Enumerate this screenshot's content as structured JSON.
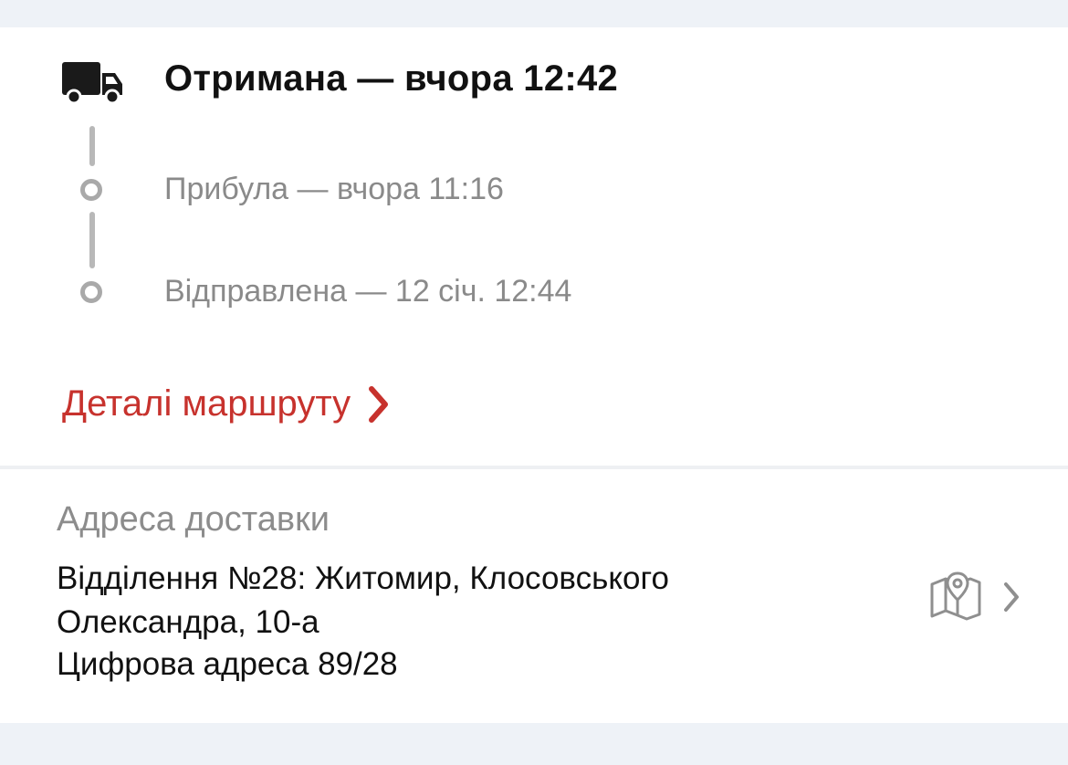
{
  "tracking": {
    "current_status": "Отримана — вчора 12:42",
    "history": [
      {
        "text": "Прибула — вчора 11:16"
      },
      {
        "text": "Відправлена — 12 січ. 12:44"
      }
    ],
    "route_details_label": "Деталі маршруту",
    "icons": {
      "current": "truck-icon",
      "history_point": "timeline-dot-icon",
      "route_link": "chevron-right-icon"
    }
  },
  "delivery": {
    "label": "Адреса доставки",
    "address_lines": [
      "Відділення №28: Житомир, Клосовського",
      "Олександра, 10-а",
      "Цифрова адреса 89/28"
    ],
    "icons": {
      "map": "map-pin-icon",
      "navigate": "chevron-right-icon"
    }
  },
  "colors": {
    "accent_red": "#c7322d",
    "primary_text": "#111111",
    "secondary_text": "#8a8a8a",
    "timeline_gray": "#b0b0b0",
    "page_background": "#eef2f7",
    "card_background": "#ffffff"
  }
}
